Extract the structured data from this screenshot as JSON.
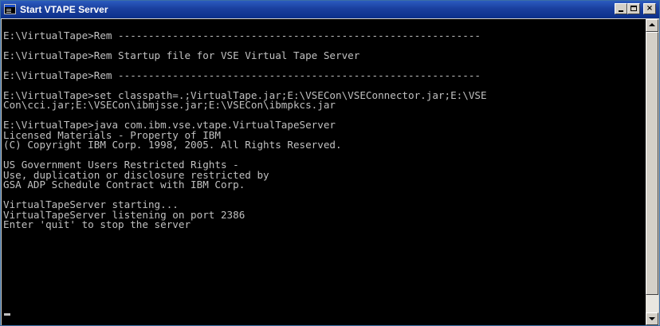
{
  "window": {
    "title": "Start VTAPE Server",
    "controls": {
      "minimize_icon": "minimize-icon",
      "maximize_icon": "maximize-icon",
      "close_icon": "close-icon",
      "close_glyph": "×"
    }
  },
  "console": {
    "lines": [
      "",
      "E:\\VirtualTape>Rem ------------------------------------------------------------",
      "",
      "E:\\VirtualTape>Rem Startup file for VSE Virtual Tape Server",
      "",
      "E:\\VirtualTape>Rem ------------------------------------------------------------",
      "",
      "E:\\VirtualTape>set classpath=.;VirtualTape.jar;E:\\VSECon\\VSEConnector.jar;E:\\VSE",
      "Con\\cci.jar;E:\\VSECon\\ibmjsse.jar;E:\\VSECon\\ibmpkcs.jar",
      "",
      "E:\\VirtualTape>java com.ibm.vse.vtape.VirtualTapeServer",
      "Licensed Materials - Property of IBM",
      "(C) Copyright IBM Corp. 1998, 2005. All Rights Reserved.",
      "",
      "US Government Users Restricted Rights -",
      "Use, duplication or disclosure restricted by",
      "GSA ADP Schedule Contract with IBM Corp.",
      "",
      "VirtualTapeServer starting...",
      "VirtualTapeServer listening on port 2386",
      "Enter 'quit' to stop the server",
      "",
      "",
      "",
      ""
    ],
    "cursor": "_"
  },
  "colors": {
    "titlebar": "#0b2f8a",
    "console_background": "#000000",
    "console_text": "#c0c0c0"
  }
}
